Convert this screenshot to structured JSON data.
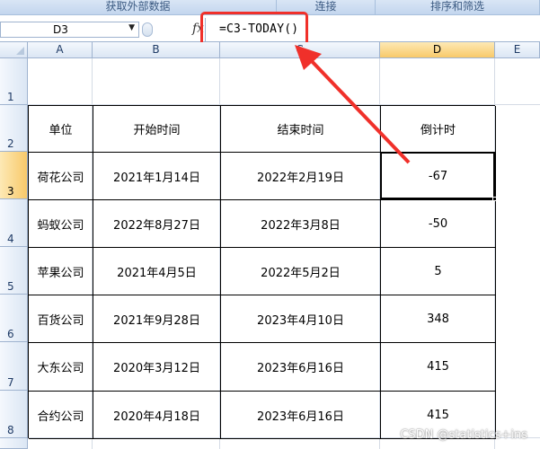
{
  "ribbon": {
    "groups": [
      "获取外部数据",
      "连接",
      "排序和筛选"
    ]
  },
  "formula_bar": {
    "name_box": "D3",
    "fx_label": "fx",
    "formula": "=C3-TODAY()"
  },
  "columns": [
    "A",
    "B",
    "C",
    "D",
    "E"
  ],
  "rows": [
    "1",
    "2",
    "3",
    "4",
    "5",
    "6",
    "7",
    "8"
  ],
  "table": {
    "headers": [
      "单位",
      "开始时间",
      "结束时间",
      "倒计时"
    ],
    "rows": [
      [
        "荷花公司",
        "2021年1月14日",
        "2022年2月19日",
        "-67"
      ],
      [
        "蚂蚁公司",
        "2022年8月27日",
        "2022年3月8日",
        "-50"
      ],
      [
        "苹果公司",
        "2021年4月5日",
        "2022年5月2日",
        "5"
      ],
      [
        "百货公司",
        "2021年9月28日",
        "2023年4月10日",
        "348"
      ],
      [
        "大东公司",
        "2020年3月12日",
        "2023年6月16日",
        "415"
      ],
      [
        "合约公司",
        "2020年4月18日",
        "2023年6月16日",
        "415"
      ]
    ]
  },
  "watermark": "CSDN @statistics+ins",
  "colors": {
    "highlight": "#f0302a",
    "selected_header": "#f8c96a"
  }
}
